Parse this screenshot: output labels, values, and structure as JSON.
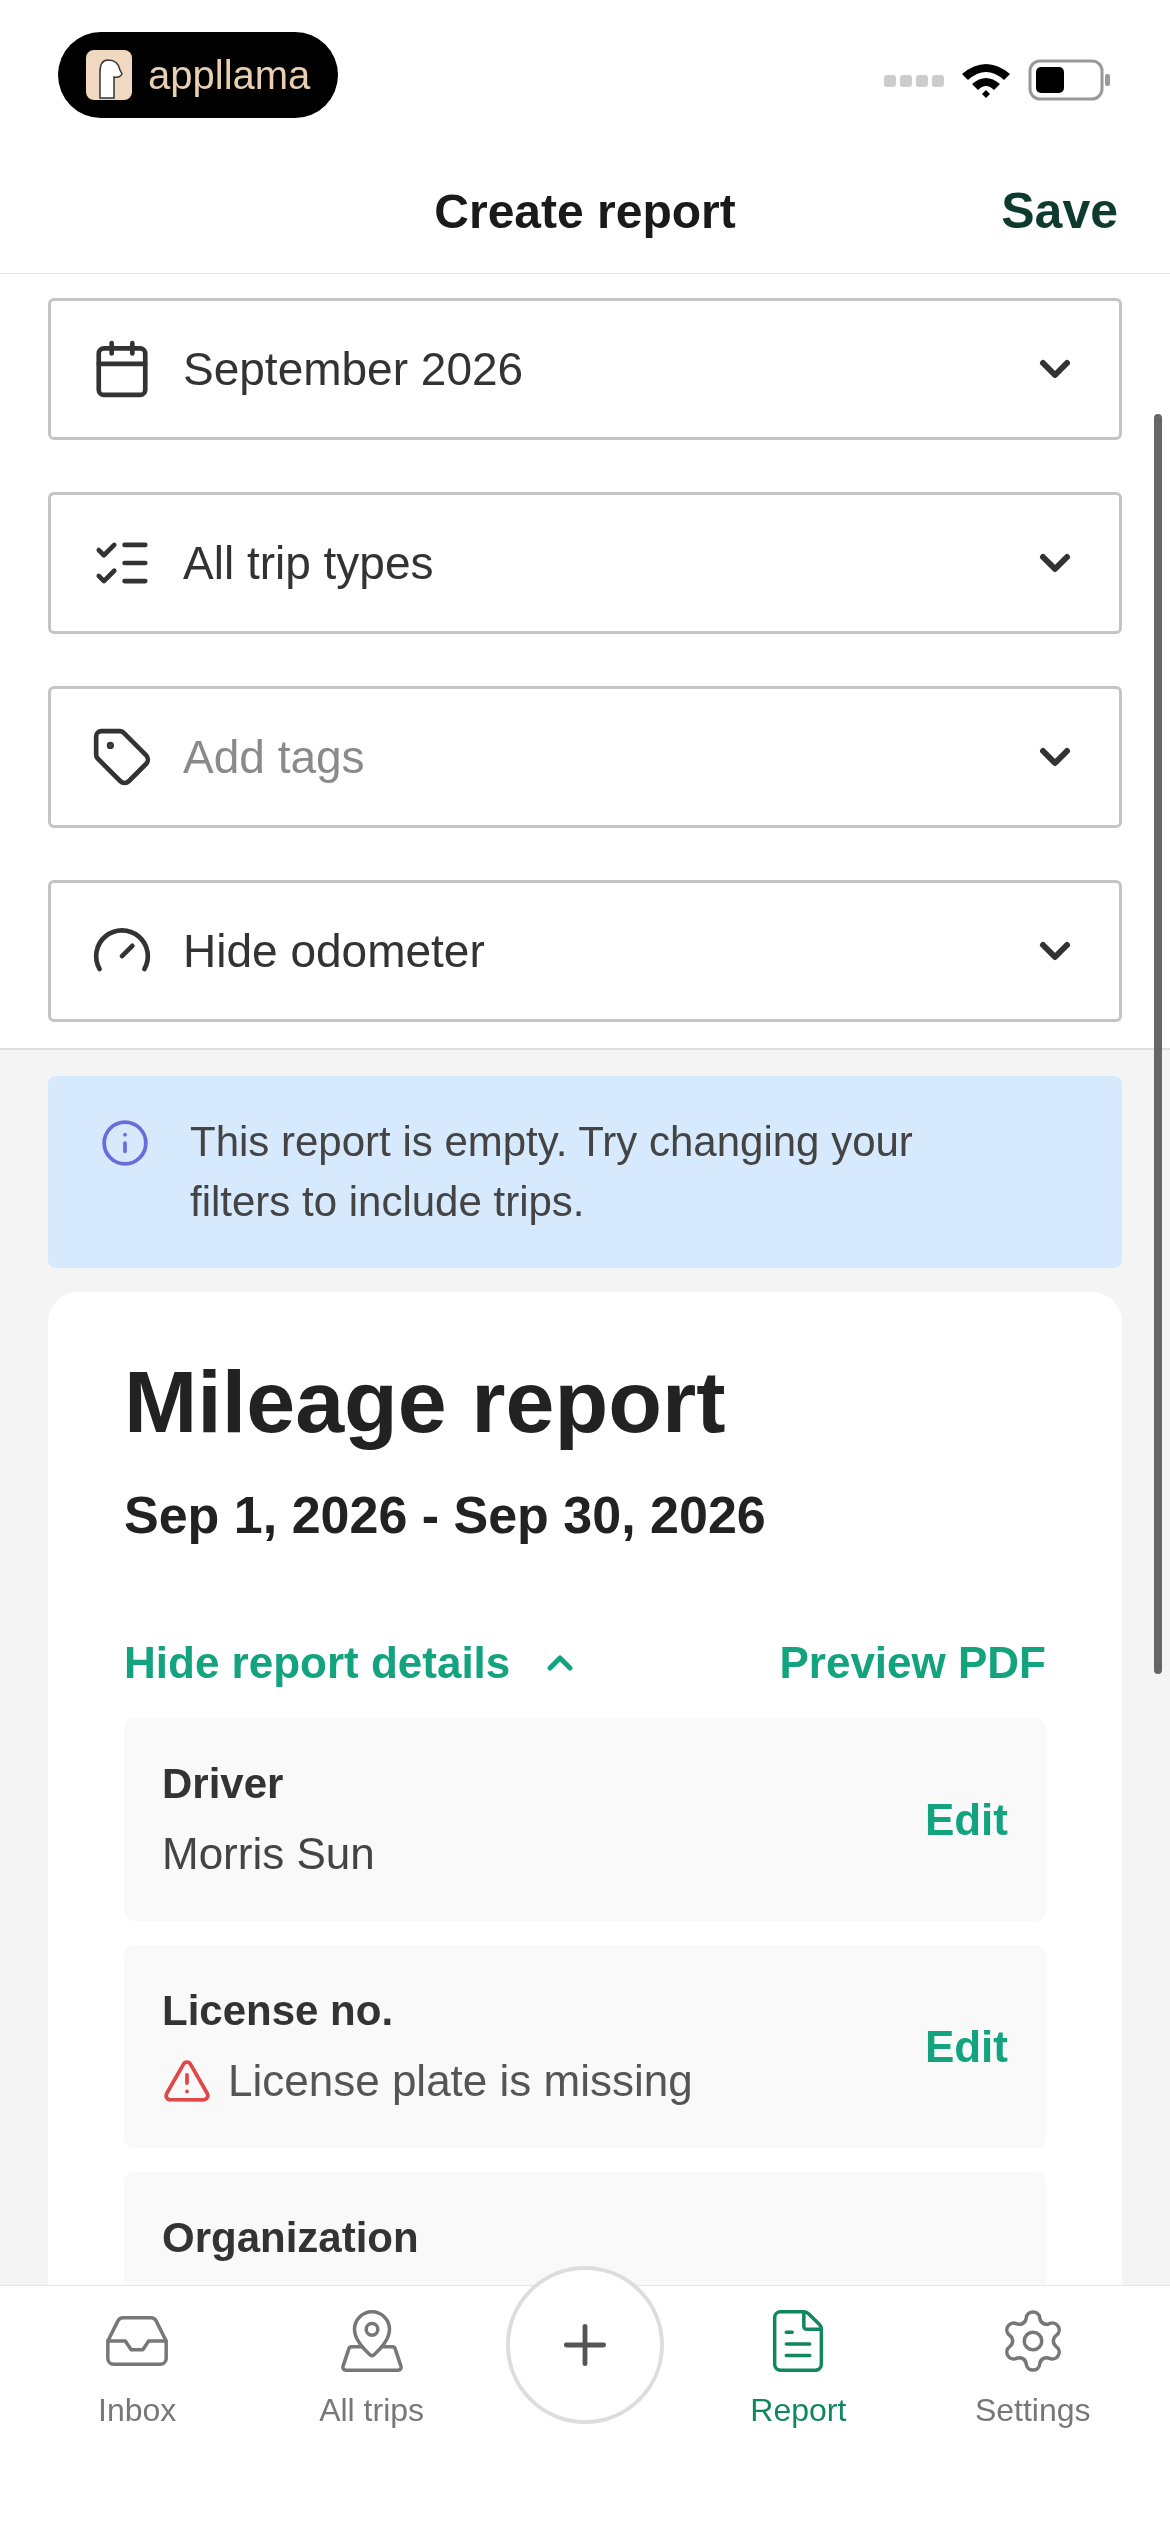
{
  "status_bar": {
    "app_badge": "appllama"
  },
  "header": {
    "title": "Create report",
    "action": "Save"
  },
  "filters": [
    {
      "value": "September 2026"
    },
    {
      "value": "All trip types"
    },
    {
      "placeholder": "Add tags"
    },
    {
      "value": "Hide odometer"
    }
  ],
  "notice": {
    "text": "This report is empty. Try changing your filters to include trips."
  },
  "report": {
    "title": "Mileage report",
    "date_range": "Sep 1, 2026 - Sep 30, 2026",
    "details_toggle": {
      "label": "Hide report details",
      "expanded": true
    },
    "preview_link": "Preview PDF",
    "details": [
      {
        "kind": "value",
        "label": "Driver",
        "value": "Morris Sun",
        "action": "Edit"
      },
      {
        "kind": "warning",
        "label": "License no.",
        "value": "License plate is missing",
        "action": "Edit"
      },
      {
        "label": "Organization"
      }
    ]
  },
  "tab_bar": [
    {
      "kind": "tab",
      "label": "Inbox",
      "selected": false
    },
    {
      "kind": "tab",
      "label": "All trips",
      "selected": false
    },
    {
      "kind": "add"
    },
    {
      "kind": "tab",
      "label": "Report",
      "selected": true
    },
    {
      "kind": "tab",
      "label": "Settings",
      "selected": false
    }
  ]
}
